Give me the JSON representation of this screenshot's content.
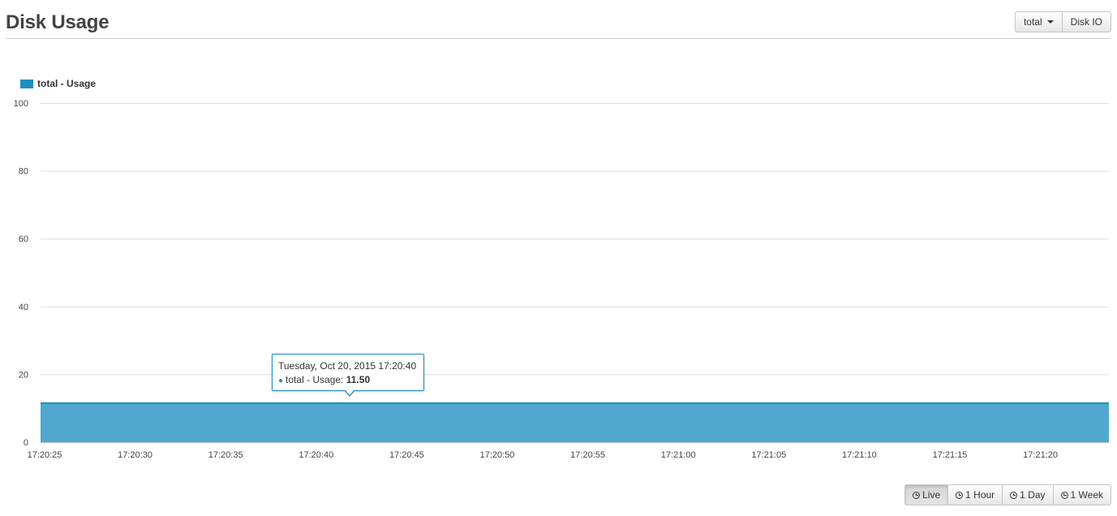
{
  "header": {
    "title": "Disk Usage",
    "disk_select_label": "total",
    "disk_io_label": "Disk IO"
  },
  "legend": {
    "label": "total - Usage",
    "color": "#1f8dbf"
  },
  "tooltip": {
    "date": "Tuesday, Oct 20, 2015 17:20:40",
    "series": "total - Usage: ",
    "value": "11.50"
  },
  "chart_data": {
    "type": "area",
    "series": [
      {
        "name": "total - Usage",
        "color": "#1f8dbf",
        "fill": "#50a8d0",
        "x": [
          "17:20:25",
          "17:20:30",
          "17:20:35",
          "17:20:40",
          "17:20:45",
          "17:20:50",
          "17:20:55",
          "17:21:00",
          "17:21:05",
          "17:21:10",
          "17:21:15",
          "17:21:20",
          "17:21:23"
        ],
        "values": [
          11.5,
          11.5,
          11.5,
          11.5,
          11.5,
          11.5,
          11.5,
          11.5,
          11.5,
          11.5,
          11.5,
          11.5,
          11.5
        ]
      }
    ],
    "x_ticks": [
      "17:20:25",
      "17:20:30",
      "17:20:35",
      "17:20:40",
      "17:20:45",
      "17:20:50",
      "17:20:55",
      "17:21:00",
      "17:21:05",
      "17:21:10",
      "17:21:15",
      "17:21:20"
    ],
    "y_ticks": [
      "0",
      "20",
      "40",
      "60",
      "80",
      "100"
    ],
    "ylim": [
      0,
      100
    ],
    "grid": true,
    "legend_position": "top-left"
  },
  "range_buttons": [
    "Live",
    "1 Hour",
    "1 Day",
    "1 Week"
  ],
  "active_range": "Live"
}
